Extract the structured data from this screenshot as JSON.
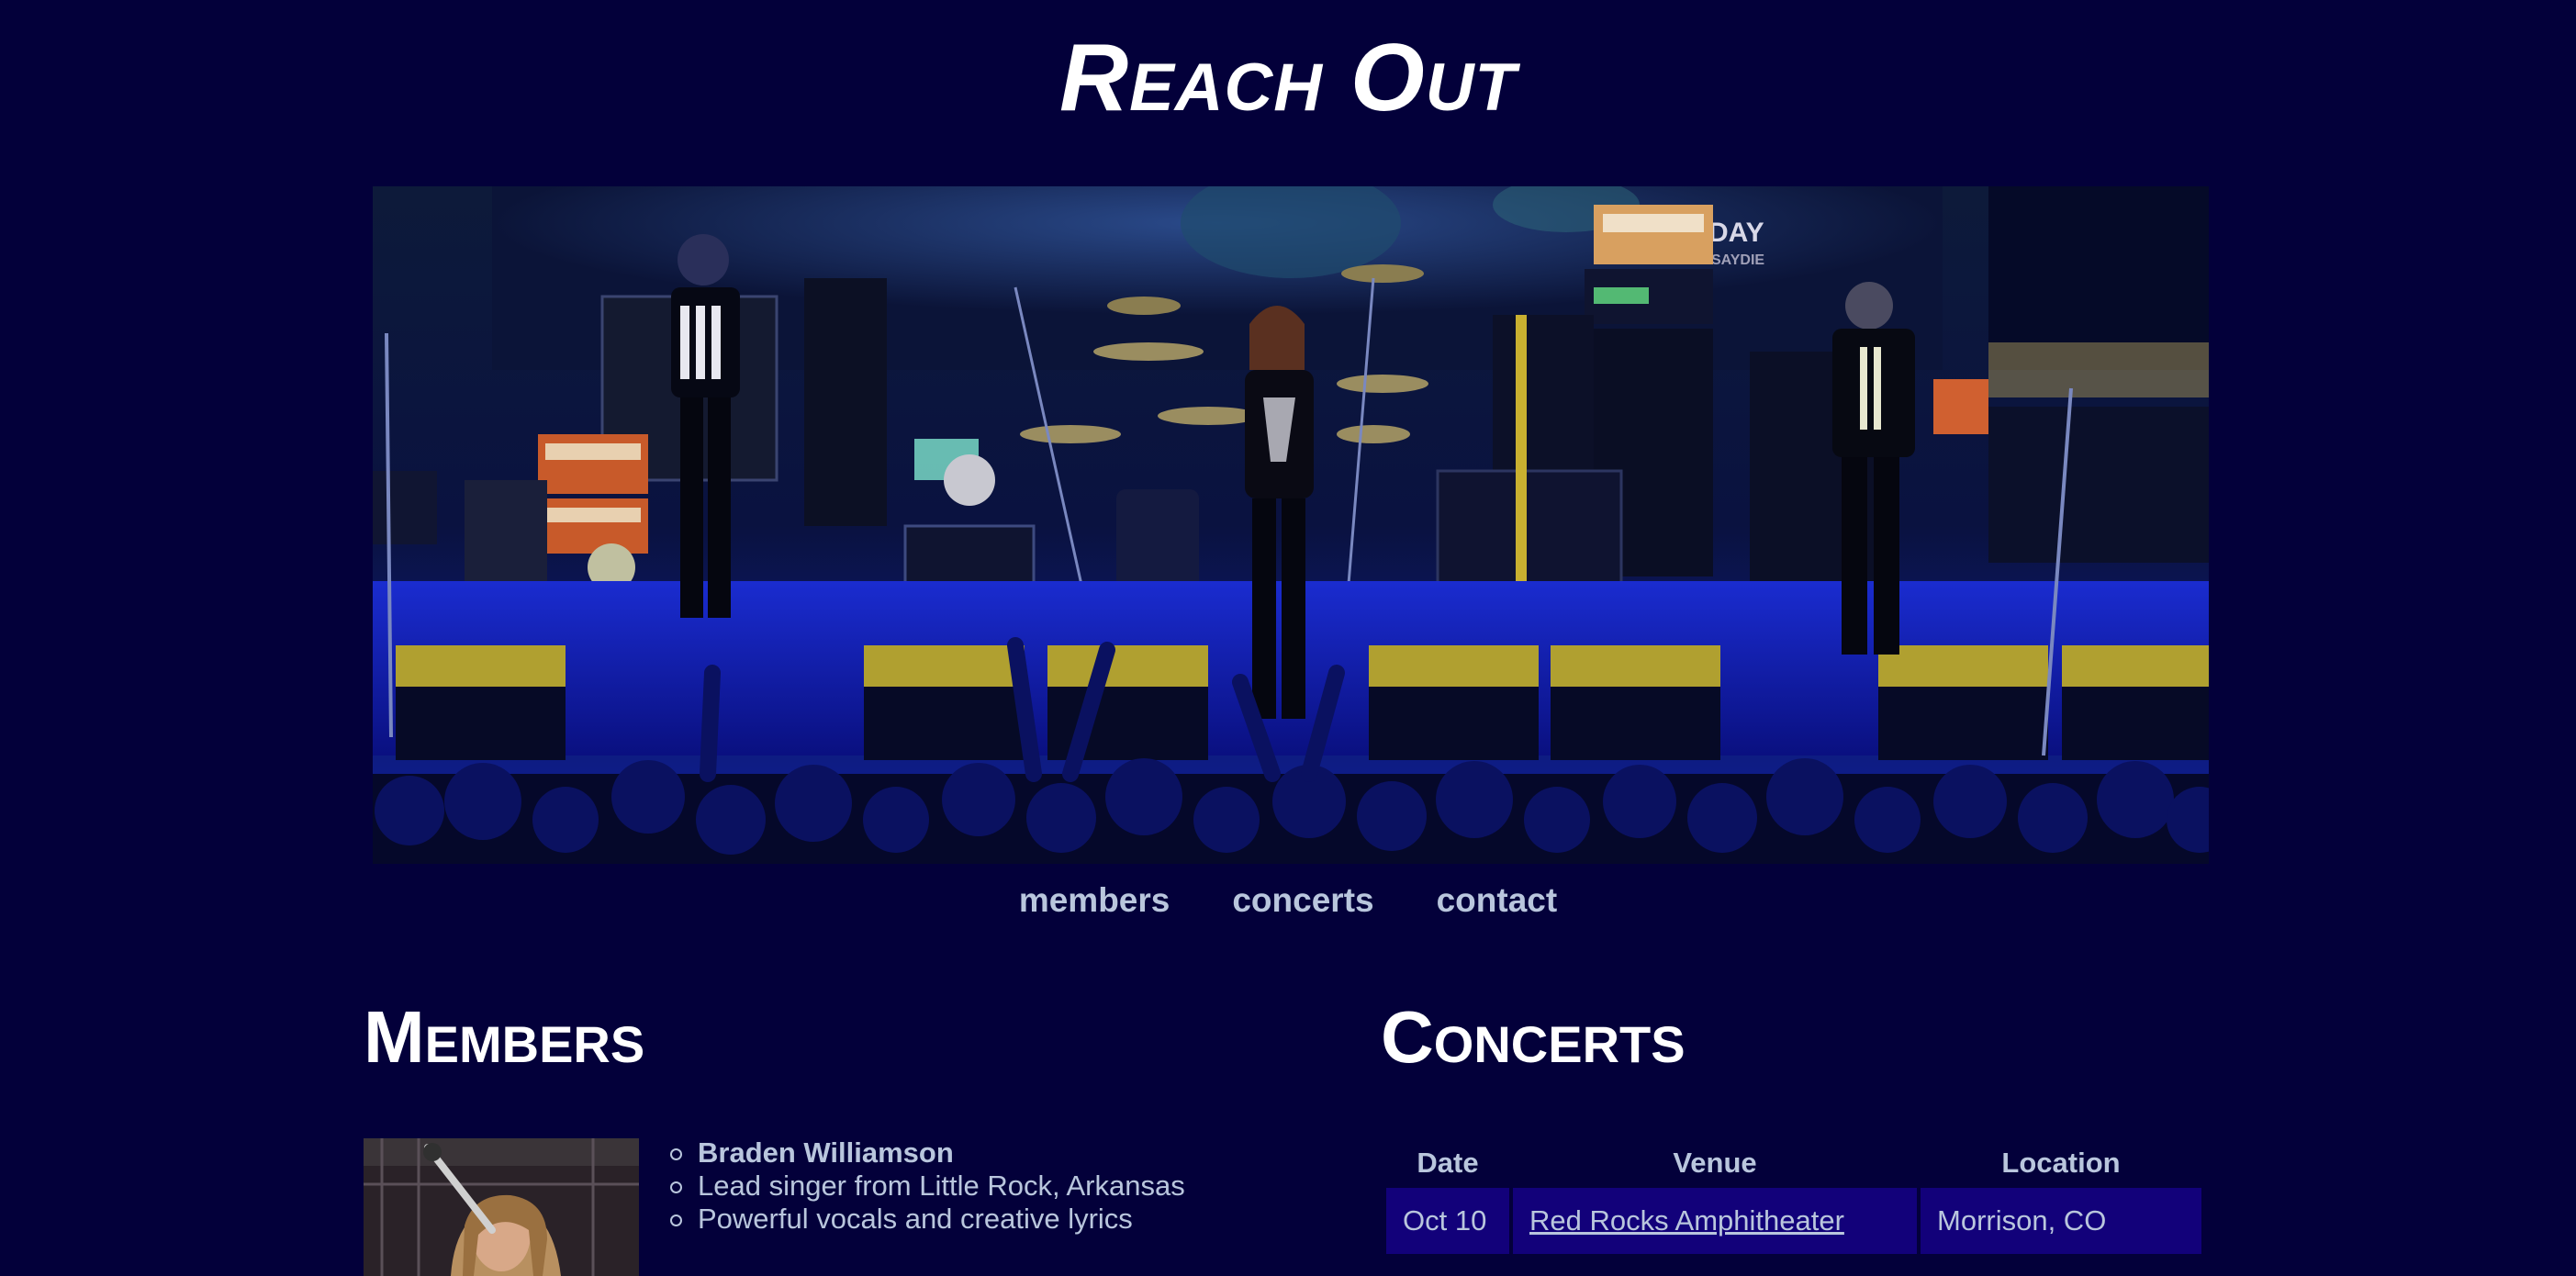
{
  "site": {
    "title": "Reach Out"
  },
  "hero": {
    "image": "band-on-stage-photo",
    "sign_text": "DAY",
    "sign_subtext": "SAYDIE"
  },
  "nav": {
    "items": [
      {
        "label": "members"
      },
      {
        "label": "concerts"
      },
      {
        "label": "contact"
      }
    ]
  },
  "members": {
    "title": "Members",
    "list": [
      {
        "name": "Braden Williamson",
        "details": [
          "Lead singer from Little Rock, Arkansas",
          "Powerful vocals and creative lyrics"
        ]
      }
    ]
  },
  "concerts": {
    "title": "Concerts",
    "columns": [
      "Date",
      "Venue",
      "Location"
    ],
    "rows": [
      {
        "date": "Oct 10",
        "venue": "Red Rocks Amphitheater",
        "location": "Morrison, CO"
      }
    ]
  },
  "colors": {
    "background": "#03003a",
    "text": "#b9c6dd",
    "heading": "#ffffff",
    "table_cell": "#12017a"
  }
}
